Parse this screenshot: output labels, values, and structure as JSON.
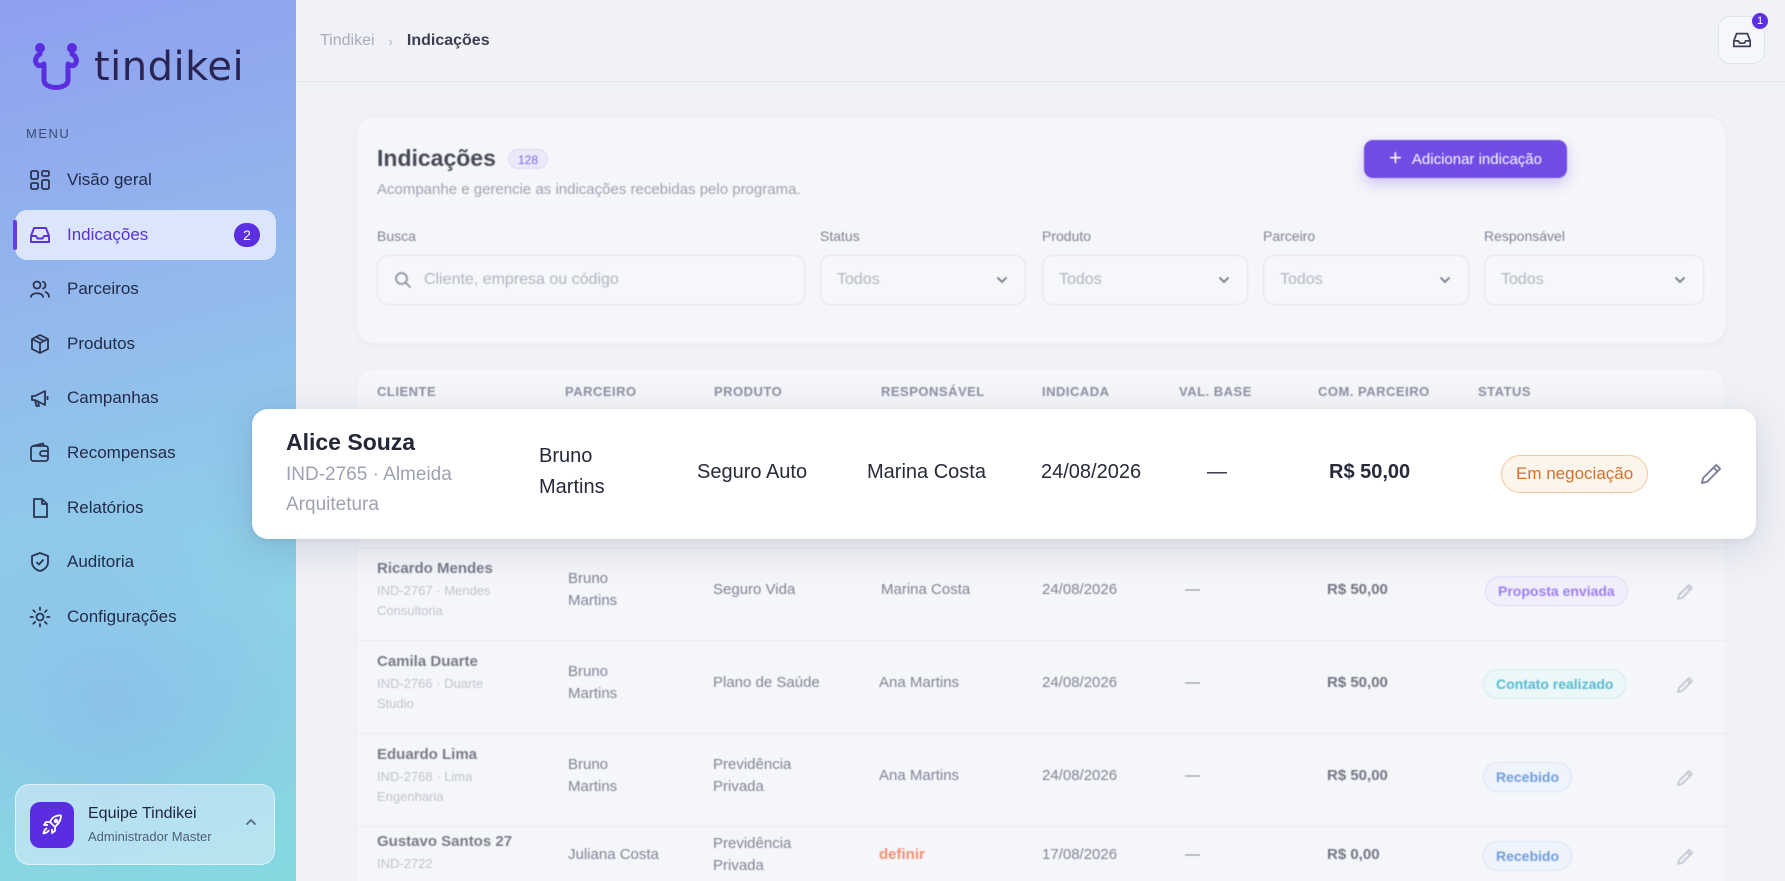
{
  "app": {
    "brand": "tindikei"
  },
  "sidebar": {
    "menu_heading": "MENU",
    "items": [
      {
        "label": "Visão geral",
        "icon": "grid-icon"
      },
      {
        "label": "Indicações",
        "icon": "inbox-icon",
        "badge": "2",
        "active": true
      },
      {
        "label": "Parceiros",
        "icon": "users-icon"
      },
      {
        "label": "Produtos",
        "icon": "box-icon"
      },
      {
        "label": "Campanhas",
        "icon": "megaphone-icon"
      },
      {
        "label": "Recompensas",
        "icon": "wallet-icon"
      },
      {
        "label": "Relatórios",
        "icon": "file-icon"
      },
      {
        "label": "Auditoria",
        "icon": "shield-icon"
      },
      {
        "label": "Configurações",
        "icon": "gear-icon"
      }
    ],
    "user": {
      "name": "Equipe Tindikei",
      "role": "Administrador Master"
    }
  },
  "topbar": {
    "breadcrumb_root": "Tindikei",
    "breadcrumb_current": "Indicações",
    "notifications_count": "1"
  },
  "header": {
    "title": "Indicações",
    "count": "128",
    "subtitle": "Acompanhe e gerencie as indicações recebidas pelo programa.",
    "add_button": "Adicionar indicação"
  },
  "filters": {
    "search_label": "Busca",
    "search_placeholder": "Cliente, empresa ou código",
    "status_label": "Status",
    "status_value": "Todos",
    "product_label": "Produto",
    "product_value": "Todos",
    "partner_label": "Parceiro",
    "partner_value": "Todos",
    "responsible_label": "Responsável",
    "responsible_value": "Todos"
  },
  "table": {
    "columns": [
      "CLIENTE",
      "PARCEIRO",
      "PRODUTO",
      "RESPONSÁVEL",
      "INDICADA",
      "VAL. BASE",
      "COM. PARCEIRO",
      "STATUS"
    ],
    "rows": [
      {
        "client": "Ricardo Mendes",
        "sub1": "IND-2767 · Mendes",
        "sub2": "Consultoria",
        "partner1": "Bruno",
        "partner2": "Martins",
        "product1": "Seguro Vida",
        "product2": "",
        "responsible": "Marina Costa",
        "date": "24/08/2026",
        "base": "—",
        "commission": "R$ 50,00",
        "status": "Proposta enviada"
      },
      {
        "client": "Camila Duarte",
        "sub1": "IND-2766 · Duarte",
        "sub2": "Studio",
        "partner1": "Bruno",
        "partner2": "Martins",
        "product1": "Plano de Saúde",
        "product2": "",
        "responsible": "Ana Martins",
        "date": "24/08/2026",
        "base": "—",
        "commission": "R$ 50,00",
        "status": "Contato realizado"
      },
      {
        "client": "Eduardo Lima",
        "sub1": "IND-2768 · Lima",
        "sub2": "Engenharia",
        "partner1": "Bruno",
        "partner2": "Martins",
        "product1": "Previdência",
        "product2": "Privada",
        "responsible": "Ana Martins",
        "date": "24/08/2026",
        "base": "—",
        "commission": "R$ 50,00",
        "status": "Recebido"
      },
      {
        "client": "Gustavo Santos 27",
        "sub1": "IND-2722",
        "sub2": "",
        "partner1": "Juliana Costa",
        "partner2": "",
        "product1": "Previdência",
        "product2": "Privada",
        "responsible": "definir",
        "date": "17/08/2026",
        "base": "—",
        "commission": "R$ 0,00",
        "status": "Recebido"
      }
    ]
  },
  "highlight": {
    "client": "Alice Souza",
    "sub1": "IND-2765 · Almeida",
    "sub2": "Arquitetura",
    "partner1": "Bruno",
    "partner2": "Martins",
    "product": "Seguro Auto",
    "responsible": "Marina Costa",
    "date": "24/08/2026",
    "base": "—",
    "commission": "R$ 50,00",
    "status": "Em negociação"
  },
  "colors": {
    "accent": "#5b2fe0",
    "status_negotiation": "#d4712a",
    "status_proposal": "#8d6ee8",
    "status_contact": "#3ab1c9",
    "status_received": "#5b8fd8"
  }
}
